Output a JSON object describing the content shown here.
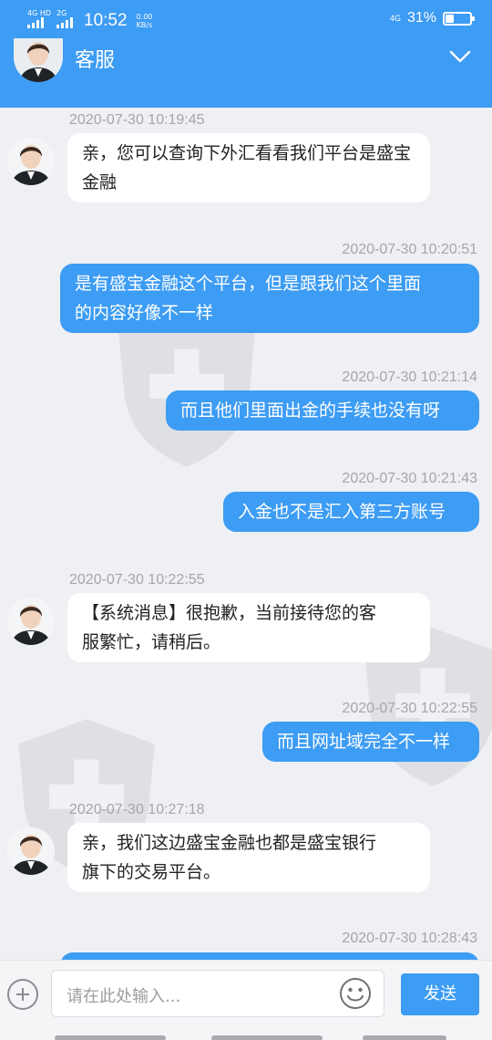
{
  "status_bar": {
    "sim1": "4G HD",
    "sim2": "2G",
    "time": "10:52",
    "speed_value": "0.00",
    "speed_unit": "KB/s",
    "network": "4G",
    "battery_text": "31%",
    "battery_level": 0.31
  },
  "header": {
    "title": "客服",
    "chevron_icon": "chevron-down"
  },
  "messages": [
    {
      "time": "2020-07-30 10:19:45",
      "direction": "in",
      "lines": [
        "亲，您可以查询下外汇看看我们平台是盛宝",
        "金融"
      ]
    },
    {
      "time": "2020-07-30 10:20:51",
      "direction": "out",
      "lines": [
        "是有盛宝金融这个平台，但是跟我们这个里面",
        "的内容好像不一样"
      ]
    },
    {
      "time": "2020-07-30 10:21:14",
      "direction": "out",
      "lines": [
        "而且他们里面出金的手续也没有呀"
      ]
    },
    {
      "time": "2020-07-30 10:21:43",
      "direction": "out",
      "lines": [
        "入金也不是汇入第三方账号"
      ]
    },
    {
      "time": "2020-07-30 10:22:55",
      "direction": "in",
      "lines": [
        "【系统消息】很抱歉，当前接待您的客",
        "服繁忙，请稍后。"
      ]
    },
    {
      "time": "2020-07-30 10:22:55",
      "direction": "out",
      "lines": [
        "而且网址域完全不一样"
      ]
    },
    {
      "time": "2020-07-30 10:27:18",
      "direction": "in",
      "lines": [
        "亲，我们这边盛宝金融也都是盛宝银行",
        "旗下的交易平台。"
      ]
    },
    {
      "time": "2020-07-30 10:28:43",
      "direction": "out",
      "lines": []
    }
  ],
  "input": {
    "placeholder": "请在此处输入...",
    "send_label": "发送"
  },
  "colors": {
    "accent": "#3d9cf3",
    "background": "#eff0f4",
    "incoming_bubble": "#ffffff",
    "timestamp": "#a4a6ab"
  }
}
